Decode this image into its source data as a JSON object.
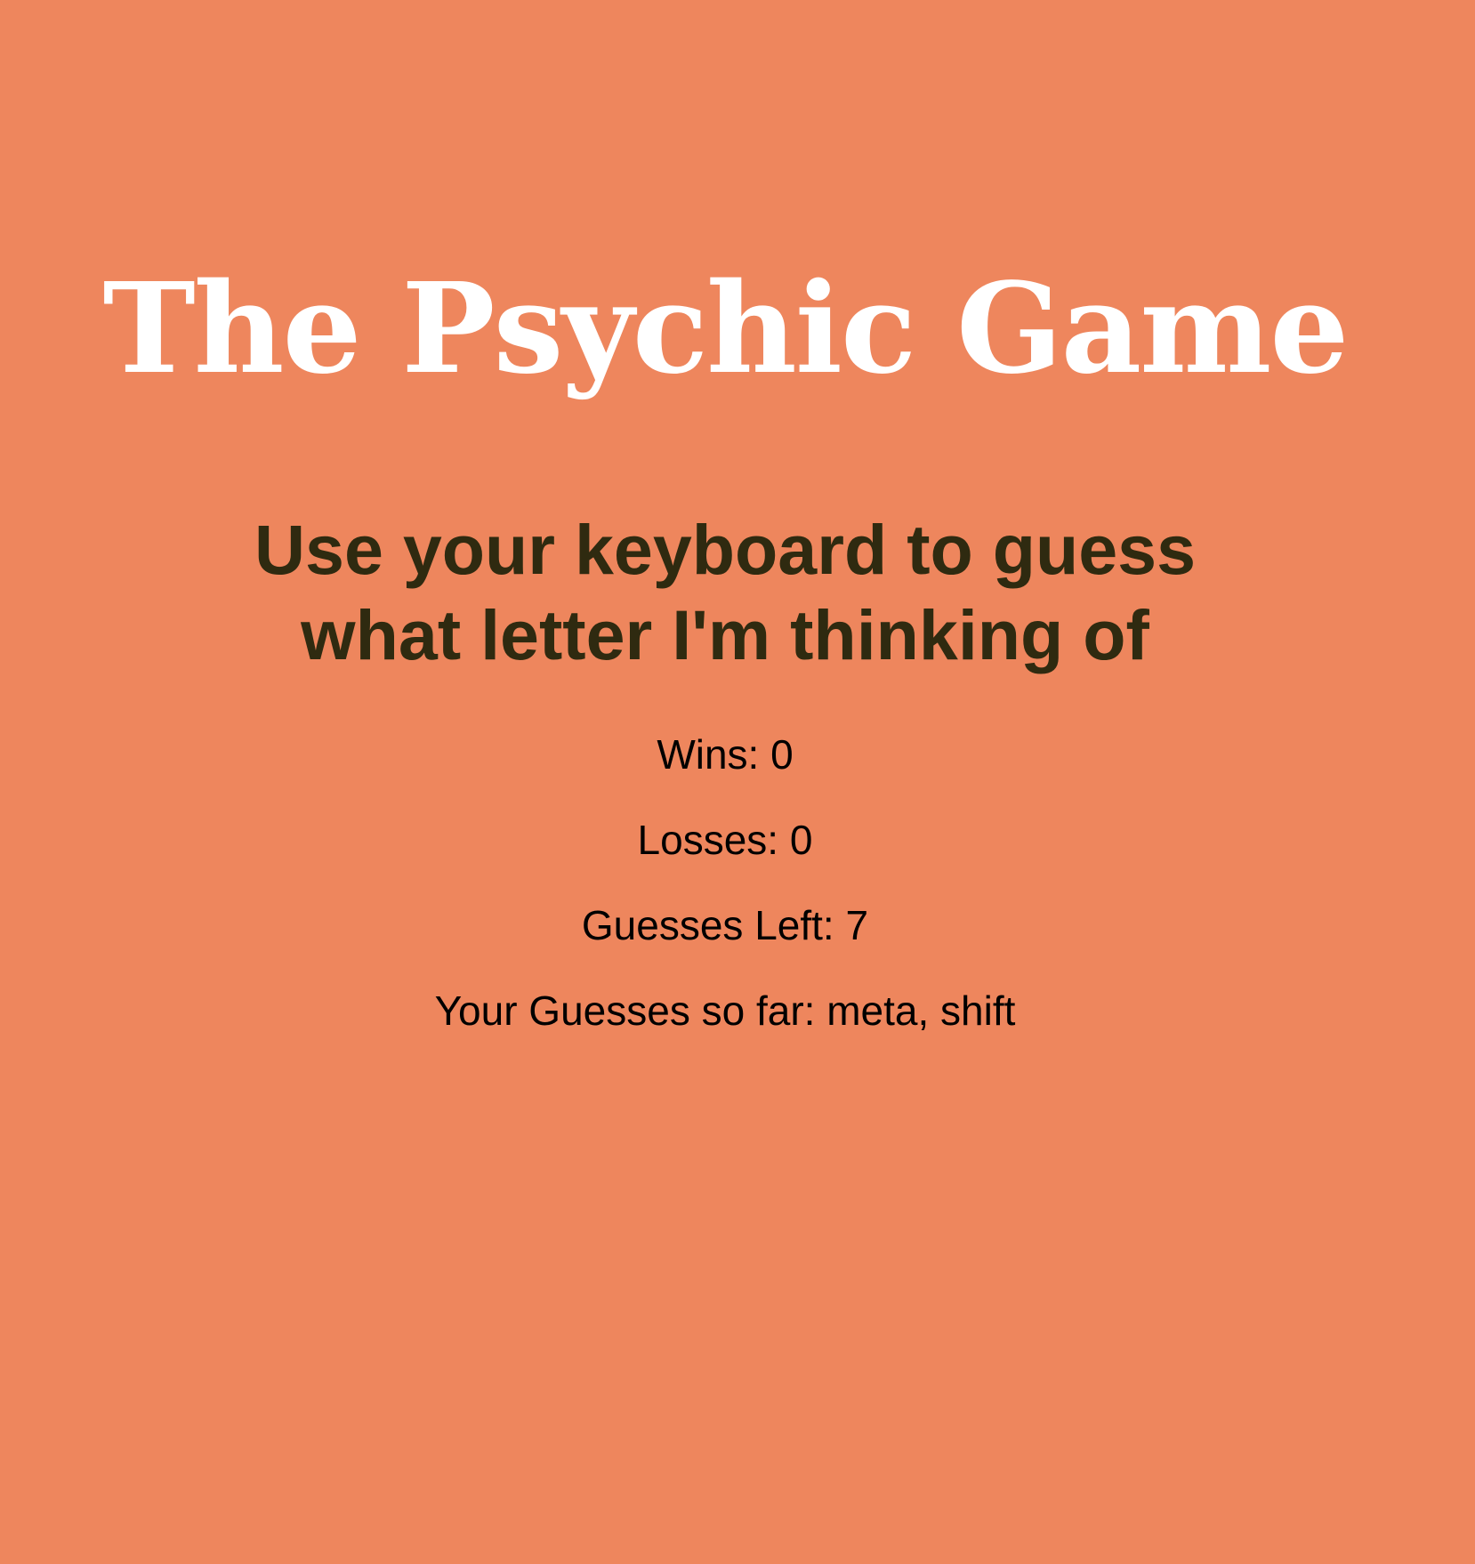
{
  "header": {
    "title": "The Psychic Game",
    "subtitle_line1": "Use your keyboard to guess",
    "subtitle_line2": "what letter I'm thinking of"
  },
  "stats": {
    "wins_label": "Wins: ",
    "wins": "0",
    "losses_label": "Losses: ",
    "losses": "0",
    "guesses_left_label": "Guesses Left: ",
    "guesses_left": "7",
    "guesses_so_far_label": "Your Guesses so far: ",
    "guesses_so_far": "meta, shift"
  },
  "colors": {
    "background": "#ee865d",
    "title": "#ffffff",
    "subtitle": "#2f2a10",
    "stats_text": "#000000"
  }
}
